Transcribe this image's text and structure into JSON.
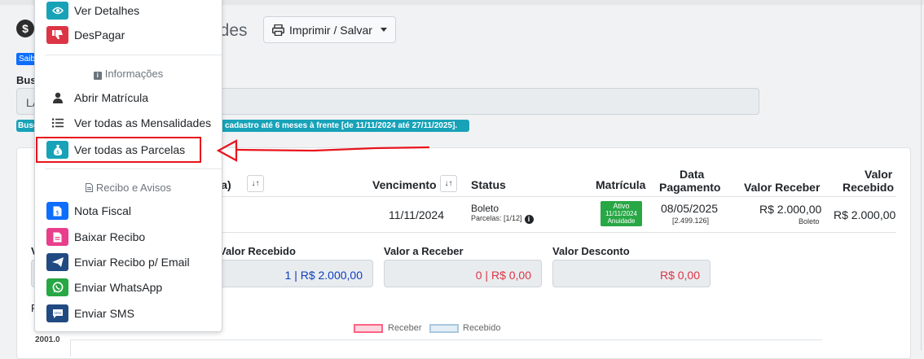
{
  "header": {
    "title_tail": "ades",
    "print_button": "Imprimir / Salvar"
  },
  "search": {
    "badge": "Saib",
    "label": "Busc",
    "value": "LA",
    "info_prefix": "Busc",
    "info_text": "cadastro até 6 meses à frente [de 11/11/2024 até 27/11/2025]."
  },
  "table": {
    "headers": {
      "aluno": "o(a)",
      "vencimento": "Vencimento",
      "status": "Status",
      "matricula": "Matrícula",
      "data_pagamento_1": "Data",
      "data_pagamento_2": "Pagamento",
      "valor_receber": "Valor Receber",
      "valor_recebido_1": "Valor",
      "valor_recebido_2": "Recebido"
    },
    "row": {
      "vencimento": "11/11/2024",
      "status": "Boleto",
      "parcelas": "Parcelas: [1/12]",
      "badge_line1": "Ativo",
      "badge_line2": "11/11/2024",
      "badge_line3": "Anuidade",
      "data_pagamento": "08/05/2025",
      "data_pagamento_sub": "[2.499.126]",
      "valor_receber": "R$ 2.000,00",
      "valor_receber_sub": "Boleto",
      "valor_recebido": "R$ 2.000,00"
    }
  },
  "summary": {
    "cut_label_v": "V",
    "cut_label_r": "R",
    "valor_recebido_label": "Valor Recebido",
    "valor_recebido": "1 | R$ 2.000,00",
    "valor_a_receber_label": "Valor a Receber",
    "valor_a_receber": "0 | R$ 0,00",
    "valor_desconto_label": "Valor Desconto",
    "valor_desconto": "R$ 0,00"
  },
  "chart": {
    "legend_receber": "Receber",
    "legend_recebido": "Recebido",
    "y_tick": "2001.0"
  },
  "menu": {
    "ver_detalhes": "Ver Detalhes",
    "despagar": "DesPagar",
    "info_header": "Informações",
    "abrir_matricula": "Abrir Matrícula",
    "ver_mensalidades": "Ver todas as Mensalidades",
    "ver_parcelas": "Ver todas as Parcelas",
    "recibo_header": "Recibo e Avisos",
    "nota_fiscal": "Nota Fiscal",
    "baixar_recibo": "Baixar Recibo",
    "enviar_email": "Enviar Recibo p/ Email",
    "enviar_whatsapp": "Enviar WhatsApp",
    "enviar_sms": "Enviar SMS"
  },
  "colors": {
    "teal": "#17a2b8",
    "red": "#dc3545",
    "blue": "#0d6efd",
    "green": "#28a745",
    "pink": "#e83e8c",
    "dark_blue": "#214a82",
    "annotation": "#e8141c"
  }
}
